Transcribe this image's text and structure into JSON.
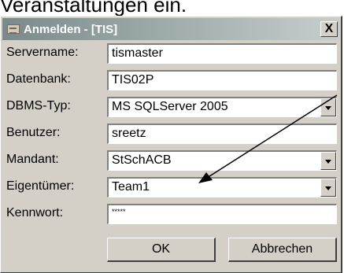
{
  "background_text": "Veranstaltungen ein.",
  "window": {
    "title": "Anmelden - [TIS]",
    "close_label": "X"
  },
  "form": {
    "rows": [
      {
        "label": "Servername:",
        "value": "tismaster",
        "type": "text"
      },
      {
        "label": "Datenbank:",
        "value": "TIS02P",
        "type": "text"
      },
      {
        "label": "DBMS-Typ:",
        "value": "MS SQLServer 2005",
        "type": "select"
      },
      {
        "label": "Benutzer:",
        "value": "sreetz",
        "type": "text"
      },
      {
        "label": "Mandant:",
        "value": "StSchACB",
        "type": "select"
      },
      {
        "label": "Eigentümer:",
        "value": "Team1",
        "type": "select"
      },
      {
        "label": "Kennwort:",
        "value": "*****",
        "type": "password"
      }
    ]
  },
  "buttons": {
    "ok": "OK",
    "cancel": "Abbrechen"
  },
  "colors": {
    "dialog_bg": "#d4d0c8",
    "title_gradient_start": "#7a8a8a",
    "title_gradient_end": "#c7cdcd"
  }
}
